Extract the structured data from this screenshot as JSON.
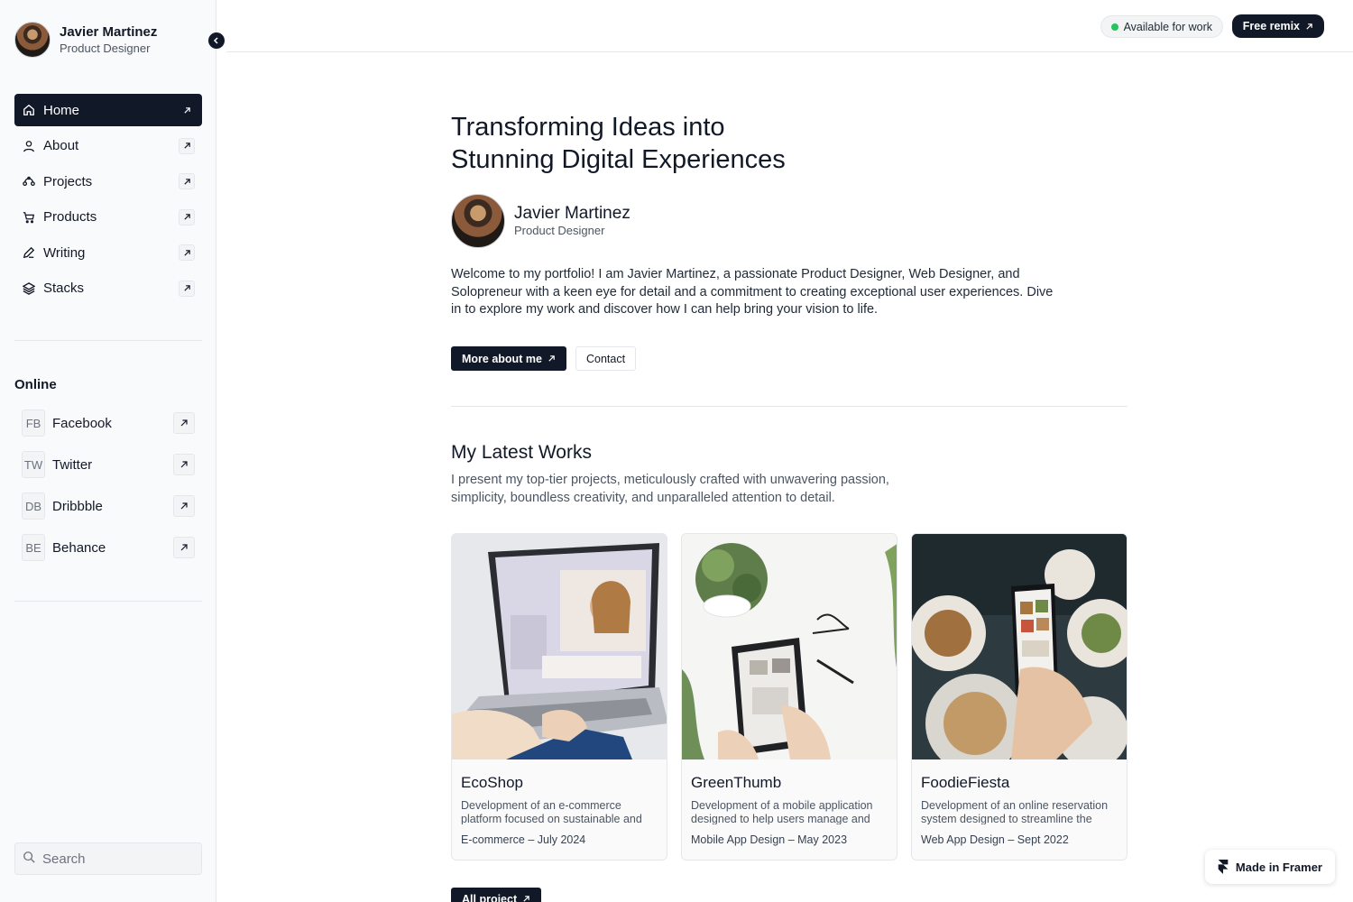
{
  "sidebar": {
    "profile": {
      "name": "Javier Martinez",
      "role": "Product Designer"
    },
    "nav": [
      {
        "label": "Home",
        "icon": "home-icon"
      },
      {
        "label": "About",
        "icon": "user-icon"
      },
      {
        "label": "Projects",
        "icon": "projects-icon"
      },
      {
        "label": "Products",
        "icon": "cart-icon"
      },
      {
        "label": "Writing",
        "icon": "pen-icon"
      },
      {
        "label": "Stacks",
        "icon": "layers-icon"
      }
    ],
    "online_title": "Online",
    "social": [
      {
        "badge": "FB",
        "label": "Facebook"
      },
      {
        "badge": "TW",
        "label": "Twitter"
      },
      {
        "badge": "DB",
        "label": "Dribbble"
      },
      {
        "badge": "BE",
        "label": "Behance"
      }
    ],
    "search_placeholder": "Search"
  },
  "topbar": {
    "status": "Available for work",
    "remix_label": "Free remix"
  },
  "hero": {
    "title_line1": "Transforming Ideas into",
    "title_line2": "Stunning Digital Experiences",
    "author_name": "Javier Martinez",
    "author_role": "Product Designer",
    "bio": "Welcome to my portfolio! I am Javier Martinez, a passionate Product Designer, Web Designer, and Solopreneur with a keen eye for detail and a commitment to creating exceptional user experiences. Dive in to explore my work and discover how I can help bring your vision to life.",
    "more_label": "More about me",
    "contact_label": "Contact"
  },
  "works": {
    "title": "My Latest Works",
    "subtitle": "I present my top-tier projects, meticulously crafted with unwavering passion, simplicity, boundless creativity, and unparalleled attention to detail.",
    "cards": [
      {
        "title": "EcoShop",
        "desc": "Development of an e-commerce platform focused on sustainable and",
        "meta": "E-commerce – July 2024"
      },
      {
        "title": "GreenThumb",
        "desc": "Development of a mobile application designed to help users manage and",
        "meta": "Mobile App Design – May 2023"
      },
      {
        "title": "FoodieFiesta",
        "desc": "Development of an online reservation system designed to streamline the",
        "meta": "Web App Design – Sept 2022"
      }
    ],
    "all_label": "All project"
  },
  "badge": {
    "framer_label": "Made in Framer"
  },
  "colors": {
    "accent": "#111827",
    "status": "#22c55e",
    "sidebar_bg": "#f9fafb"
  }
}
